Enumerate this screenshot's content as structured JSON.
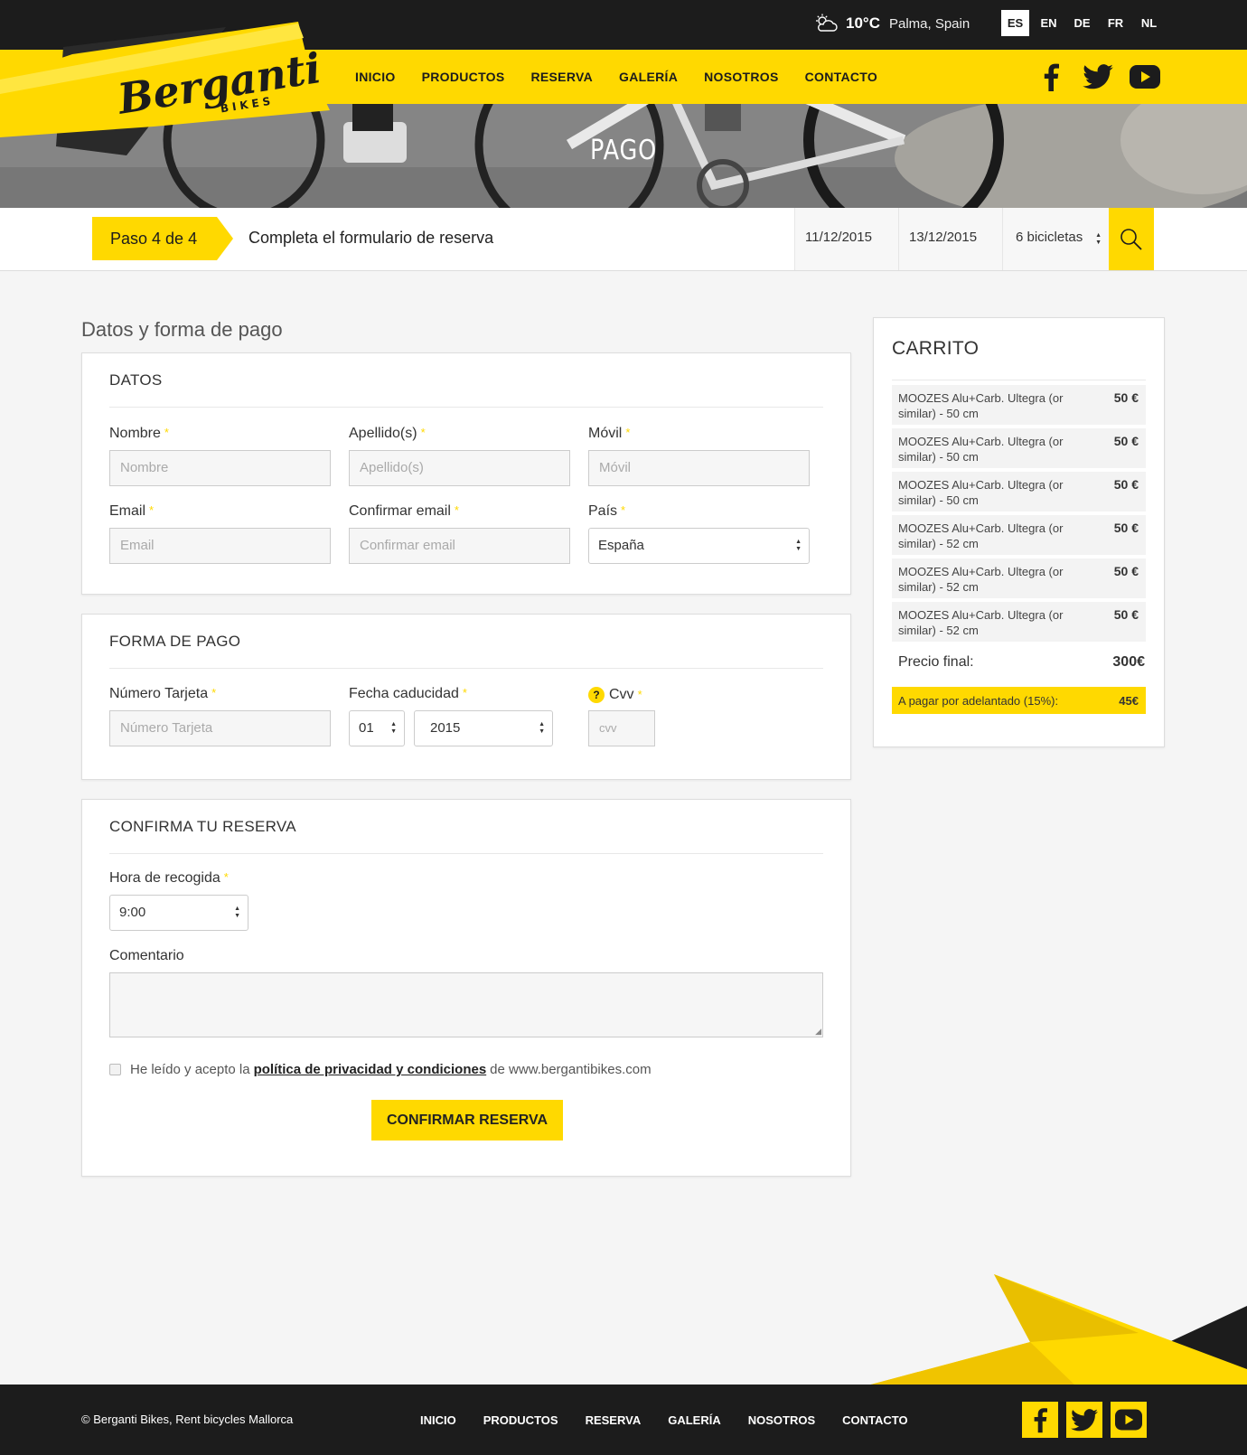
{
  "header": {
    "weather": {
      "temperature": "10°C",
      "location": "Palma, Spain",
      "icon": "partly-cloudy-icon"
    },
    "languages": [
      {
        "code": "ES",
        "active": true
      },
      {
        "code": "EN",
        "active": false
      },
      {
        "code": "DE",
        "active": false
      },
      {
        "code": "FR",
        "active": false
      },
      {
        "code": "NL",
        "active": false
      }
    ],
    "logo": {
      "brand": "Berganti",
      "sub": "BIKES"
    },
    "nav": [
      "INICIO",
      "PRODUCTOS",
      "RESERVA",
      "GALERÍA",
      "NOSOTROS",
      "CONTACTO"
    ],
    "social": [
      "facebook-icon",
      "twitter-icon",
      "youtube-icon"
    ]
  },
  "hero": {
    "title": "PAGO"
  },
  "step_bar": {
    "step": "Paso 4 de 4",
    "description": "Completa el formulario de reserva",
    "date_from": "11/12/2015",
    "date_to": "13/12/2015",
    "bikes": "6 bicicletas",
    "search_icon": "search-icon"
  },
  "main": {
    "title": "Datos y forma de pago",
    "datos": {
      "heading": "DATOS",
      "nombre": {
        "label": "Nombre",
        "placeholder": "Nombre"
      },
      "apellidos": {
        "label": "Apellido(s)",
        "placeholder": "Apellido(s)"
      },
      "movil": {
        "label": "Móvil",
        "placeholder": "Móvil"
      },
      "email": {
        "label": "Email",
        "placeholder": "Email"
      },
      "confirm_email": {
        "label": "Confirmar email",
        "placeholder": "Confirmar email"
      },
      "pais": {
        "label": "País",
        "value": "España"
      }
    },
    "pago": {
      "heading": "FORMA DE PAGO",
      "card": {
        "label": "Número Tarjeta",
        "placeholder": "Número Tarjeta"
      },
      "expiry": {
        "label": "Fecha caducidad",
        "month": "01",
        "year": "2015"
      },
      "cvv": {
        "label": "Cvv",
        "placeholder": "cvv",
        "help": "?"
      }
    },
    "confirmar": {
      "heading": "CONFIRMA TU RESERVA",
      "hora": {
        "label": "Hora de recogida",
        "value": "9:00"
      },
      "comentario": {
        "label": "Comentario"
      },
      "terms": {
        "before": "He leído y acepto la",
        "link": "política de privacidad y condiciones",
        "after": "de www.bergantibikes.com"
      },
      "button": "CONFIRMAR RESERVA"
    },
    "required_mark": "*"
  },
  "cart": {
    "title": "CARRITO",
    "items": [
      {
        "name": "MOOZES Alu+Carb. Ultegra (or similar) - 50 cm",
        "price": "50 €"
      },
      {
        "name": "MOOZES Alu+Carb. Ultegra (or similar) - 50 cm",
        "price": "50 €"
      },
      {
        "name": "MOOZES Alu+Carb. Ultegra (or similar) - 50 cm",
        "price": "50 €"
      },
      {
        "name": "MOOZES Alu+Carb. Ultegra (or similar) - 52 cm",
        "price": "50 €"
      },
      {
        "name": "MOOZES Alu+Carb. Ultegra (or similar) - 52 cm",
        "price": "50 €"
      },
      {
        "name": "MOOZES Alu+Carb. Ultegra (or similar) - 52 cm",
        "price": "50 €"
      }
    ],
    "total_label": "Precio final:",
    "total": "300€",
    "deposit_label": "A pagar por adelantado (15%):",
    "deposit": "45€"
  },
  "footer": {
    "copyright": "© Berganti Bikes, Rent bicycles Mallorca",
    "nav": [
      "INICIO",
      "PRODUCTOS",
      "RESERVA",
      "GALERÍA",
      "NOSOTROS",
      "CONTACTO"
    ],
    "social": [
      "facebook-icon",
      "twitter-icon",
      "youtube-icon"
    ]
  },
  "colors": {
    "accent": "#ffd900",
    "dark": "#1c1c1c"
  }
}
